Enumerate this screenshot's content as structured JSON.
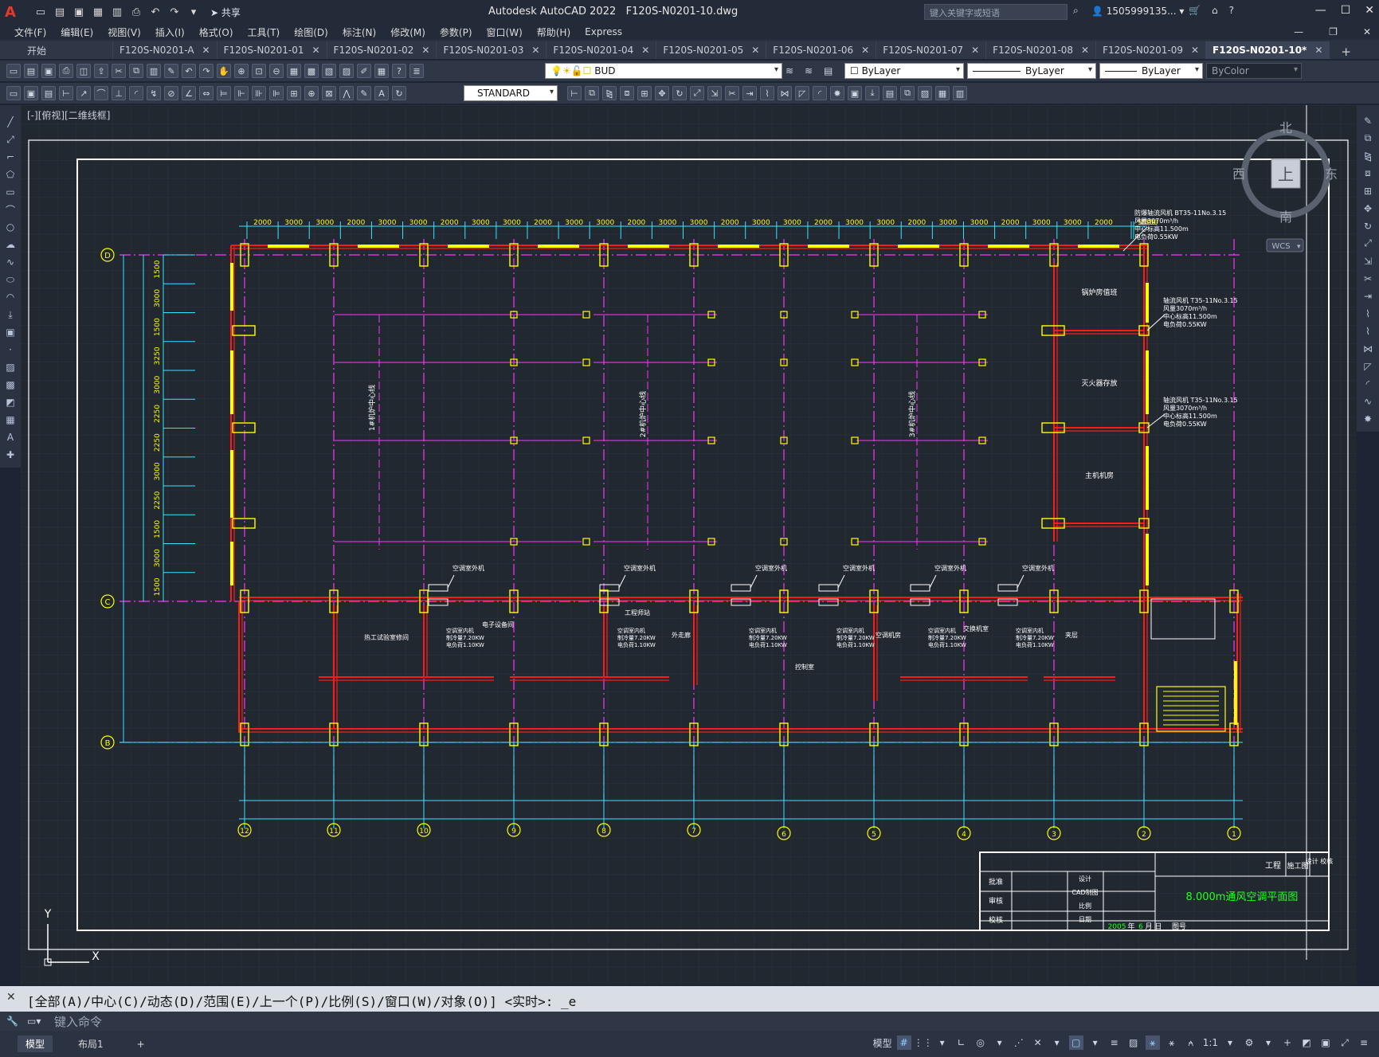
{
  "app": {
    "name": "Autodesk AutoCAD 2022",
    "file": "F120S-N0201-10.dwg",
    "share_label": "共享",
    "search_placeholder": "键入关键字或短语",
    "user_id": "1505999135..."
  },
  "menu": [
    "文件(F)",
    "编辑(E)",
    "视图(V)",
    "插入(I)",
    "格式(O)",
    "工具(T)",
    "绘图(D)",
    "标注(N)",
    "修改(M)",
    "参数(P)",
    "窗口(W)",
    "帮助(H)",
    "Express"
  ],
  "tabs": [
    {
      "label": "开始",
      "closable": false
    },
    {
      "label": "F120S-N0201-A",
      "closable": true
    },
    {
      "label": "F120S-N0201-01",
      "closable": true
    },
    {
      "label": "F120S-N0201-02",
      "closable": true
    },
    {
      "label": "F120S-N0201-03",
      "closable": true
    },
    {
      "label": "F120S-N0201-04",
      "closable": true
    },
    {
      "label": "F120S-N0201-05",
      "closable": true
    },
    {
      "label": "F120S-N0201-06",
      "closable": true
    },
    {
      "label": "F120S-N0201-07",
      "closable": true
    },
    {
      "label": "F120S-N0201-08",
      "closable": true
    },
    {
      "label": "F120S-N0201-09",
      "closable": true
    },
    {
      "label": "F120S-N0201-10*",
      "closable": true,
      "active": true
    }
  ],
  "properties": {
    "layer": "BUD",
    "color": "ByLayer",
    "linetype": "ByLayer",
    "lineweight": "ByLayer",
    "plotstyle": "ByColor",
    "textstyle": "STANDARD"
  },
  "viewport": {
    "label": "[-][俯视][二维线框]",
    "viewcube": {
      "north": "北",
      "south": "南",
      "east": "东",
      "west": "西",
      "top": "上",
      "wcs": "WCS"
    }
  },
  "drawing": {
    "top_dims": [
      "2000",
      "3000",
      "3000",
      "2000",
      "3000",
      "3000",
      "2000",
      "3000",
      "3000",
      "2000",
      "3000",
      "3000",
      "2000",
      "3000",
      "3000",
      "2000",
      "3000",
      "3000",
      "2000",
      "3000",
      "3000",
      "2000",
      "3000",
      "3000",
      "2000",
      "3000",
      "3000",
      "2000",
      "5500",
      "1500"
    ],
    "left_dims": [
      "1500",
      "3000",
      "1500",
      "3250",
      "3000",
      "2250",
      "2250",
      "3000",
      "2250",
      "1500",
      "3000",
      "1500"
    ],
    "axis_rows": [
      "D",
      "C",
      "B"
    ],
    "axis_cols": [
      "12",
      "11",
      "10",
      "9",
      "8",
      "7",
      "6",
      "5",
      "4",
      "3",
      "2",
      "1"
    ],
    "rooms": [
      "锅炉房值班",
      "灭火器存放",
      "主机机房",
      "热工试验室修间",
      "电子设备间",
      "工程师站",
      "外走廊",
      "空调机房",
      "控制室",
      "夹层",
      "交换机室",
      "单元机组控制室"
    ],
    "notes": {
      "hall_a": "1#机炉中心线",
      "hall_b": "2#机炉中心线",
      "hall_c": "3#机炉中心线",
      "fan_1": "防爆轴流风机 BT35-11No.3.15 风量3070m³/h 中心标高11.500m 电负荷0.55KW",
      "fan_2": "轴流风机 T35-11No.3.15 风量3070m³/h 中心标高11.500m 电负荷0.55KW",
      "fan_3": "轴流风机 T35-11No.3.15 风量3070m³/h 中心标高11.500m 电负荷0.55KW",
      "ac_outdoor": "空调室外机",
      "ac_indoor": "空调室内机 制冷量7.20KW 电负荷1.10KW"
    },
    "title_block": {
      "drawing_title": "8.000m通风空调平面图",
      "project": "工程",
      "stage": "施工图",
      "design_check": "设计 校核",
      "rows": [
        "批准",
        "审核",
        "校核"
      ],
      "roles": [
        "设计",
        "CAD制图",
        "比例",
        "日期"
      ],
      "date_year": "2005",
      "date_month": "6",
      "year_label": "年",
      "month_label": "月",
      "day_label": "日",
      "drawing_no_label": "图号"
    }
  },
  "command": {
    "history": "[全部(A)/中心(C)/动态(D)/范围(E)/上一个(P)/比例(S)/窗口(W)/对象(O)] <实时>: _e",
    "placeholder": "键入命令"
  },
  "status": {
    "layout_tabs": [
      "模型",
      "布局1"
    ],
    "model_label": "模型",
    "scale": "1:1"
  },
  "colors": {
    "wall": "#ff1a1a",
    "axis_line": "#ff33ff",
    "dim_line": "#33e6ff",
    "column": "#ffff00",
    "note": "#ffffff",
    "title_green": "#22ff22"
  }
}
